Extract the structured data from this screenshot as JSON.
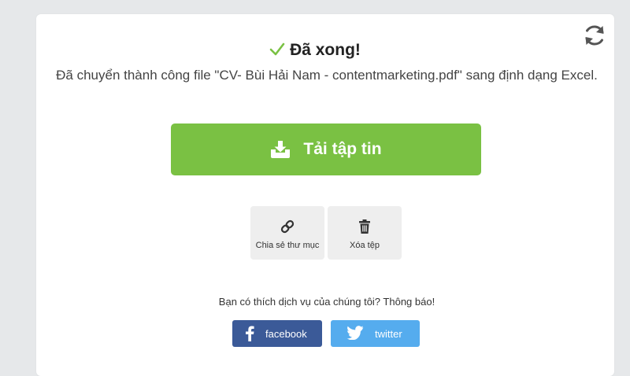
{
  "result": {
    "title": "Đã xong!",
    "message": "Đã chuyển thành công file \"CV- Bùi Hải Nam - contentmarketing.pdf\" sang định dạng Excel."
  },
  "download": {
    "label": "Tải tập tin"
  },
  "actions": {
    "share_label": "Chia sẻ thư mục",
    "delete_label": "Xóa tệp"
  },
  "feedback": {
    "question": "Bạn có thích dịch vụ của chúng tôi? Thông báo!",
    "facebook_label": "facebook",
    "twitter_label": "twitter"
  },
  "icons": {
    "refresh": "refresh-icon",
    "check": "check-icon",
    "download": "download-icon",
    "share": "link-icon",
    "delete": "trash-icon",
    "facebook": "facebook-icon",
    "twitter": "twitter-icon"
  },
  "colors": {
    "accent_green": "#7ac143",
    "facebook_blue": "#3b5a98",
    "twitter_blue": "#55acee",
    "tile_bg": "#eeeeee",
    "page_bg": "#e6e8ea"
  }
}
